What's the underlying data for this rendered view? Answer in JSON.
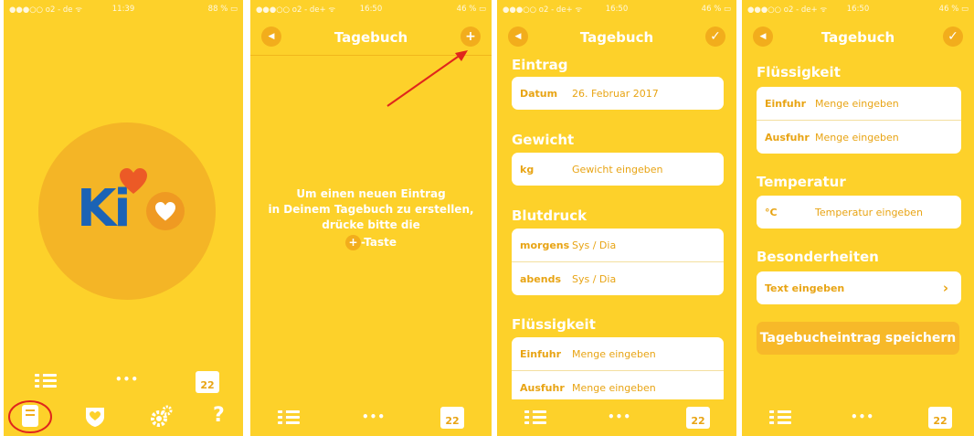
{
  "screen1": {
    "status": {
      "carrier": "●●●○○ o2 - de ᯤ",
      "time": "11:39",
      "battery": "88 % ▭"
    },
    "logo": {
      "letters": "Ki"
    },
    "calendar_day": "22",
    "help_label": "?"
  },
  "screen2": {
    "status": {
      "carrier": "●●●○○ o2 - de+ ᯤ",
      "time": "16:50",
      "battery": "46 % ▭"
    },
    "title": "Tagebuch",
    "back_glyph": "◀",
    "add_glyph": "+",
    "empty_message": {
      "line1": "Um einen neuen Eintrag",
      "line2": "in Deinem Tagebuch zu erstellen,",
      "line3": "drücke bitte die",
      "line4_suffix": "-Taste",
      "plus": "+"
    },
    "calendar_day": "22"
  },
  "screen3": {
    "status": {
      "carrier": "●●●○○ o2 - de+ ᯤ",
      "time": "16:50",
      "battery": "46 % ▭"
    },
    "title": "Tagebuch",
    "back_glyph": "◀",
    "confirm_glyph": "✓",
    "sections": {
      "eintrag": {
        "title": "Eintrag",
        "label": "Datum",
        "value": "26. Februar 2017"
      },
      "gewicht": {
        "title": "Gewicht",
        "label": "kg",
        "placeholder": "Gewicht eingeben"
      },
      "blutdruck": {
        "title": "Blutdruck",
        "morning_label": "morgens",
        "morning_placeholder": "Sys / Dia",
        "evening_label": "abends",
        "evening_placeholder": "Sys / Dia"
      },
      "fluessigkeit": {
        "title": "Flüssigkeit",
        "intake_label": "Einfuhr",
        "intake_placeholder": "Menge eingeben",
        "output_label": "Ausfuhr",
        "output_placeholder": "Menge eingeben"
      }
    },
    "calendar_day": "22"
  },
  "screen4": {
    "status": {
      "carrier": "●●●○○ o2 - de+ ᯤ",
      "time": "16:50",
      "battery": "46 % ▭"
    },
    "title": "Tagebuch",
    "back_glyph": "◀",
    "confirm_glyph": "✓",
    "sections": {
      "fluessigkeit": {
        "title": "Flüssigkeit",
        "intake_label": "Einfuhr",
        "intake_placeholder": "Menge eingeben",
        "output_label": "Ausfuhr",
        "output_placeholder": "Menge eingeben"
      },
      "temperatur": {
        "title": "Temperatur",
        "label": "°C",
        "placeholder": "Temperatur eingeben"
      },
      "besonderheiten": {
        "title": "Besonderheiten",
        "placeholder": "Text eingeben",
        "chevron": "›"
      }
    },
    "save_label": "Tagebucheintrag speichern",
    "calendar_day": "22"
  },
  "colors": {
    "background": "#fdd12a",
    "accent": "#f2ad1c",
    "text_orange": "#e8a414",
    "logo_blue": "#1b63b5",
    "heart_red": "#ec5a26",
    "annotation_red": "#e0261c"
  }
}
